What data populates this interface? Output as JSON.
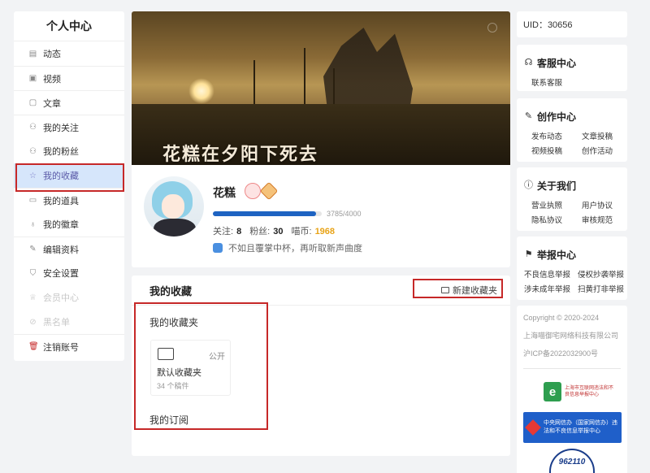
{
  "sidebar": {
    "title": "个人中心",
    "items": [
      {
        "label": "动态",
        "icon": "feed-icon"
      },
      {
        "label": "视频",
        "icon": "video-icon"
      },
      {
        "label": "文章",
        "icon": "article-icon"
      },
      {
        "label": "我的关注",
        "icon": "follow-icon"
      },
      {
        "label": "我的粉丝",
        "icon": "fans-icon"
      },
      {
        "label": "我的收藏",
        "icon": "star-icon"
      },
      {
        "label": "我的道具",
        "icon": "props-icon"
      },
      {
        "label": "我的徽章",
        "icon": "badge-icon"
      },
      {
        "label": "编辑资料",
        "icon": "edit-icon"
      },
      {
        "label": "安全设置",
        "icon": "shield-icon"
      },
      {
        "label": "会员中心",
        "icon": "crown-icon"
      },
      {
        "label": "黑名单",
        "icon": "blacklist-icon"
      },
      {
        "label": "注销账号",
        "icon": "trash-icon"
      }
    ],
    "active_item": "我的收藏"
  },
  "banner": {
    "caption": "花糕在夕阳下死去"
  },
  "profile": {
    "username": "花糕",
    "exp_text": "3785/4000",
    "exp_progress": 0.946,
    "stats": {
      "following_label": "关注:",
      "following": "8",
      "fans_label": "粉丝:",
      "fans": "30",
      "coins_label": "喵币:",
      "coins": "1968"
    },
    "signature": "不如且覆掌中杯，再听取新声曲度"
  },
  "collection": {
    "title": "我的收藏",
    "new_button": "新建收藏夹",
    "folders_title": "我的收藏夹",
    "folder": {
      "name": "默认收藏夹",
      "visibility": "公开",
      "count": "34 个稿件"
    },
    "subscriptions_title": "我的订阅"
  },
  "right": {
    "uid": "UID：30656",
    "service": {
      "title": "客服中心",
      "links": [
        "联系客服"
      ]
    },
    "creation": {
      "title": "创作中心",
      "links": [
        "发布动态",
        "文章投稿",
        "视频投稿",
        "创作活动"
      ]
    },
    "about": {
      "title": "关于我们",
      "links": [
        "营业执照",
        "用户协议",
        "隐私协议",
        "审核规范"
      ]
    },
    "report": {
      "title": "举报中心",
      "links": [
        "不良信息举报",
        "侵权抄袭举报",
        "涉未成年举报",
        "扫黄打非举报"
      ]
    },
    "footer": {
      "copyright": "Copyright © 2020-2024",
      "company": "上海喵御宅网络科技有限公司",
      "icp": "沪ICP备2022032900号",
      "logo1_text": "上海市互联网违法和不良信息举报中心",
      "logo2_text": "中央网信办（国家网信办）违法和不良信息举报中心",
      "logo3_text": "962110"
    }
  },
  "colors": {
    "accent": "#1e63c2",
    "active_bg": "#d6e6fb",
    "highlight_box": "#c62828",
    "coin": "#e8a317"
  }
}
